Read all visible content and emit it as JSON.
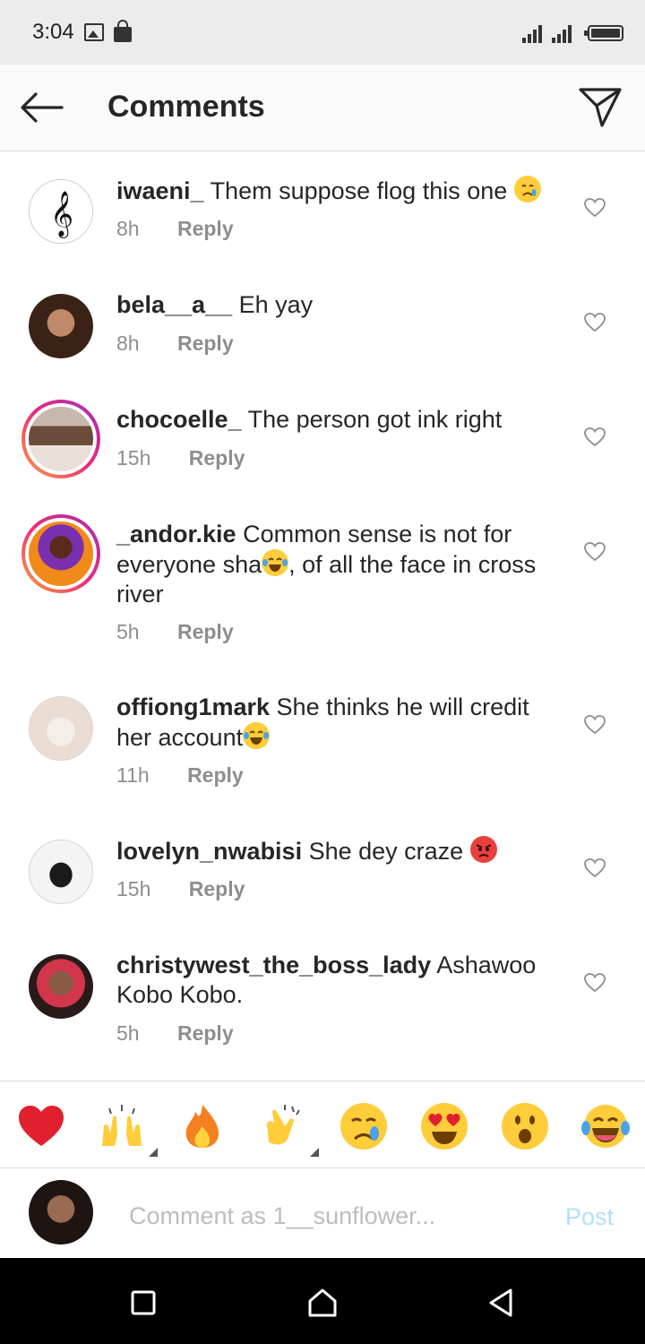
{
  "status_bar": {
    "time": "3:04",
    "icons": [
      "image-icon",
      "lock-icon",
      "signal-icon",
      "signal-icon",
      "battery-icon"
    ]
  },
  "header": {
    "title": "Comments",
    "back_icon": "arrow-left-icon",
    "share_icon": "paper-plane-icon"
  },
  "comments": [
    {
      "username": "iwaeni_",
      "text": "Them suppose flog this one",
      "emoji": "crying-face",
      "time": "8h",
      "reply": "Reply",
      "avatar": "treble-clef"
    },
    {
      "username": "bela__a__",
      "text": "Eh yay",
      "time": "8h",
      "reply": "Reply",
      "avatar": "photo"
    },
    {
      "username": "chocoelle_",
      "text": "The person got ink right",
      "time": "15h",
      "reply": "Reply",
      "avatar": "photo-story-ring"
    },
    {
      "username": "_andor.kie",
      "text": "Common sense is not for everyone sha",
      "emoji": "tears-of-joy",
      "text_after": ", of all the face in cross river",
      "time": "5h",
      "reply": "Reply",
      "avatar": "illustration-story-ring"
    },
    {
      "username": "offiong1mark",
      "text": "She thinks he will credit her account",
      "emoji": "tears-of-joy",
      "time": "11h",
      "reply": "Reply",
      "avatar": "photo"
    },
    {
      "username": "lovelyn_nwabisi",
      "text": "She dey craze",
      "emoji": "angry-face",
      "time": "15h",
      "reply": "Reply",
      "avatar": "photo"
    },
    {
      "username": "christywest_the_boss_lady",
      "text": "Ashawoo Kobo Kobo.",
      "time": "5h",
      "reply": "Reply",
      "avatar": "photo"
    }
  ],
  "reactions": [
    "red-heart",
    "raising-hands",
    "fire",
    "clapping-hands",
    "crying-face",
    "heart-eyes",
    "surprised-face",
    "tears-of-joy"
  ],
  "composer": {
    "placeholder": "Comment as 1__sunflower...",
    "post_label": "Post"
  },
  "colors": {
    "text": "#262626",
    "meta": "#8e8e8e",
    "post_disabled": "#b2dffc",
    "heart": "#e0202e",
    "emoji_yellow": "#ffcc3a"
  }
}
